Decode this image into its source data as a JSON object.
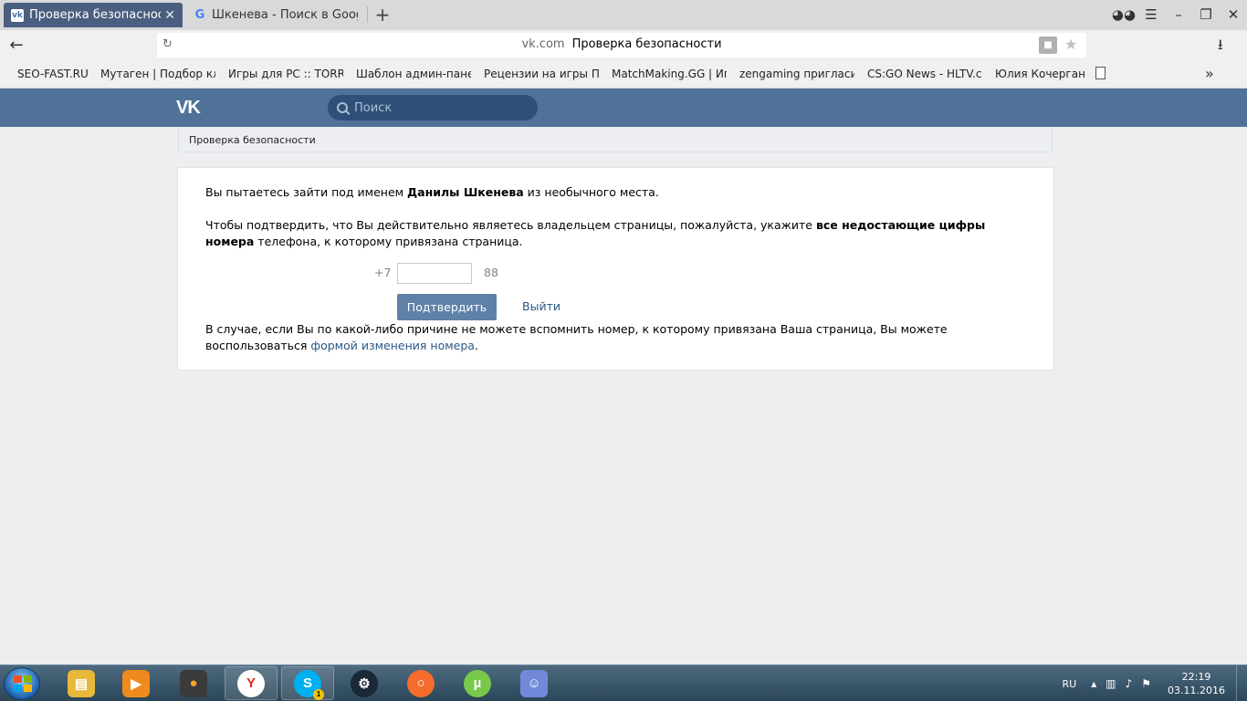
{
  "browser": {
    "tabs": [
      {
        "title": "Проверка безопасности",
        "favicon": "vk-icon",
        "active": true
      },
      {
        "title": "Шкенева - Поиск в Google",
        "favicon": "google-icon",
        "active": false
      }
    ],
    "new_tab_glyph": "+",
    "url_domain": "vk.com",
    "url_title": "Проверка безопасности",
    "bookmarks": [
      "SEO-FAST.RU",
      "Мутаген | Подбор кл",
      "Игры для PC :: TORRE",
      "Шаблон админ-пане",
      "Рецензии на игры П",
      "MatchMaking.GG | Иг",
      "zengaming пригласи",
      "CS:GO News - HLTV.c",
      "Юлия Кочерган"
    ],
    "bookmarks_more": "»"
  },
  "vk": {
    "logo": "VK",
    "search_placeholder": "Поиск",
    "breadcrumb": "Проверка безопасности",
    "p1_before": "Вы пытаетесь зайти под именем ",
    "p1_name": "Данилы Шкенева",
    "p1_after": " из необычного места.",
    "p2_before": "Чтобы подтвердить, что Вы действительно являетесь владельцем страницы, пожалуйста, укажите ",
    "p2_bold": "все недостающие цифры номера",
    "p2_after": " телефона, к которому привязана страница.",
    "phone_prefix": "+7",
    "phone_value": "",
    "phone_suffix": "88",
    "confirm_label": "Подтвердить",
    "logout_label": "Выйти",
    "p3_before": "В случае, если Вы по какой-либо причине не можете вспомнить номер, к которому привязана Ваша страница, Вы можете воспользоваться ",
    "p3_link": "формой изменения номера",
    "p3_after": "."
  },
  "taskbar": {
    "apps": [
      {
        "name": "explorer-icon",
        "color": "#e8b83a"
      },
      {
        "name": "media-player-icon",
        "color": "#f08a1c"
      },
      {
        "name": "fl-studio-icon",
        "color": "#f5a623"
      },
      {
        "name": "yandex-browser-icon",
        "color": "#ffffff"
      },
      {
        "name": "skype-icon",
        "color": "#00aff0"
      },
      {
        "name": "steam-icon",
        "color": "#1b2838"
      },
      {
        "name": "origin-icon",
        "color": "#f56c2d"
      },
      {
        "name": "utorrent-icon",
        "color": "#78c84a"
      },
      {
        "name": "discord-icon",
        "color": "#7289da"
      }
    ],
    "skype_badge": "1",
    "lang": "RU",
    "time": "22:19",
    "date": "03.11.2016"
  }
}
